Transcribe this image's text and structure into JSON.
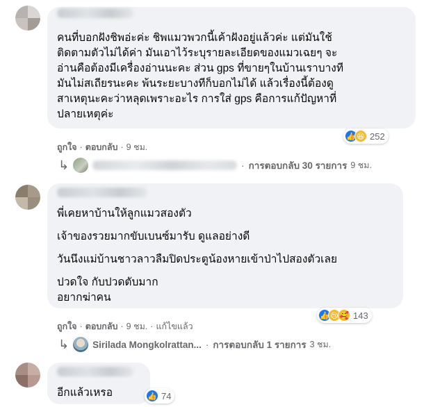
{
  "comments": [
    {
      "lines": [
        "คนที่บอกฝังชิพอ่ะค่ะ ชิพแมวพวกนี้เค้าฝังอยู่แล้วค่ะ แต่มันใช้",
        "ติดตามตัวไม่ได้ค่า มันเอาไว้ระบุรายละเอียดของแมวเฉยๆ จะ",
        "อ่านคือต้องมีเครื่องอ่านนะคะ ส่วน gps ที่ขายๆในบ้านเราบางที",
        "มันไม่สเถียรนะคะ พ้นระยะบางทีก็บอกไม่ได้ แล้วเรื่องนี้ต้องดู",
        "สาเหตุนะคะว่าหลุดเพราะอะไร การใส่ gps คือการแก้ปัญหาที่",
        "ปลายเหตุค่ะ"
      ],
      "reaction_count": "252",
      "actions": {
        "like": "ถูกใจ",
        "reply": "ตอบกลับ",
        "time": "9 ชม."
      },
      "replies": {
        "label": "การตอบกลับ 30 รายการ",
        "time": "9 ชม."
      }
    },
    {
      "paragraphs": [
        "พี่เคยหาบ้านให้ลูกแมวสองตัว",
        "เจ้าของรวยมากขับเบนซ์มารับ ดูแลอย่างดี",
        "วันนึงแม่บ้านชาวลาวลืมปิดประตูน้องหายเข้าป่าไปสองตัวเลย",
        "ปวดใจ กับปวดตับมาก",
        "อยากฆ่าคน"
      ],
      "reaction_count": "143",
      "actions": {
        "like": "ถูกใจ",
        "reply": "ตอบกลับ",
        "time": "9 ชม.",
        "edited": "แก้ไขแล้ว"
      },
      "replies": {
        "author": "Sirilada Mongkolrattan...",
        "label": "การตอบกลับ 1 รายการ",
        "time": "3 ชม."
      }
    },
    {
      "text": "อีกแล้วเหรอ",
      "reaction_count": "74"
    }
  ],
  "separator": "·",
  "icons": {
    "reply_arrow": "reply-arrow-icon",
    "like": "like-reaction-icon",
    "haha": "haha-reaction-icon",
    "sad": "sad-reaction-icon",
    "care": "care-reaction-icon"
  },
  "colors": {
    "bubble": "#f0f2f5",
    "meta": "#65676b",
    "like_blue": "#1877f2"
  }
}
